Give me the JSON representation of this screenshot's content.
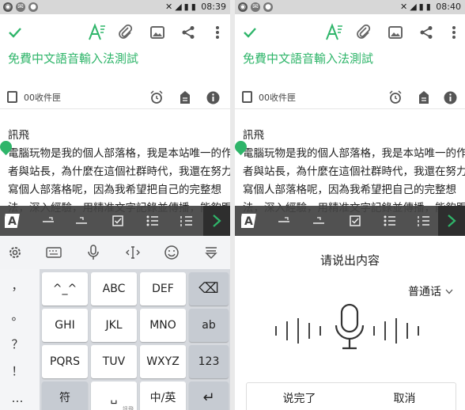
{
  "left": {
    "status_time": "08:39",
    "note_title": "免費中文語音輸入法測試",
    "notebook": "00收件匣",
    "body_lines": [
      "訊飛",
      "電腦玩物是我的個人部落格，我是本站唯一的作",
      "者與站長，為什麼在這個社群時代，我還在努力",
      "寫個人部落格呢，因為我希望把自己的完整想",
      "法，深入經驗，用精准文字記錄並傳播，能夠跟"
    ],
    "keyboard": {
      "symbols": [
        "，",
        "。",
        "？",
        "！",
        "…"
      ],
      "rows": [
        [
          "^_^",
          "ABC",
          "DEF",
          "⌫"
        ],
        [
          "GHI",
          "JKL",
          "MNO",
          "ab"
        ],
        [
          "PQRS",
          "TUV",
          "WXYZ",
          "123"
        ],
        [
          "符",
          "␣",
          "中/英",
          "↵"
        ]
      ],
      "space_sub": "訊飛"
    }
  },
  "right": {
    "status_time": "08:40",
    "note_title": "免費中文語音輸入法測試",
    "notebook": "00收件匣",
    "body_lines": [
      "訊飛",
      "電腦玩物是我的個人部落格，我是本站唯一的作",
      "者與站長，為什麼在這個社群時代，我還在努力",
      "寫個人部落格呢，因為我希望把自己的完整想",
      "法，深入經驗，用精准文字記錄並傳播，能夠跟"
    ],
    "voice": {
      "title": "请说出内容",
      "language": "普通话",
      "done_label": "说完了",
      "cancel_label": "取消"
    }
  },
  "colors": {
    "accent": "#2fb56a",
    "fmtbar": "#444444"
  }
}
